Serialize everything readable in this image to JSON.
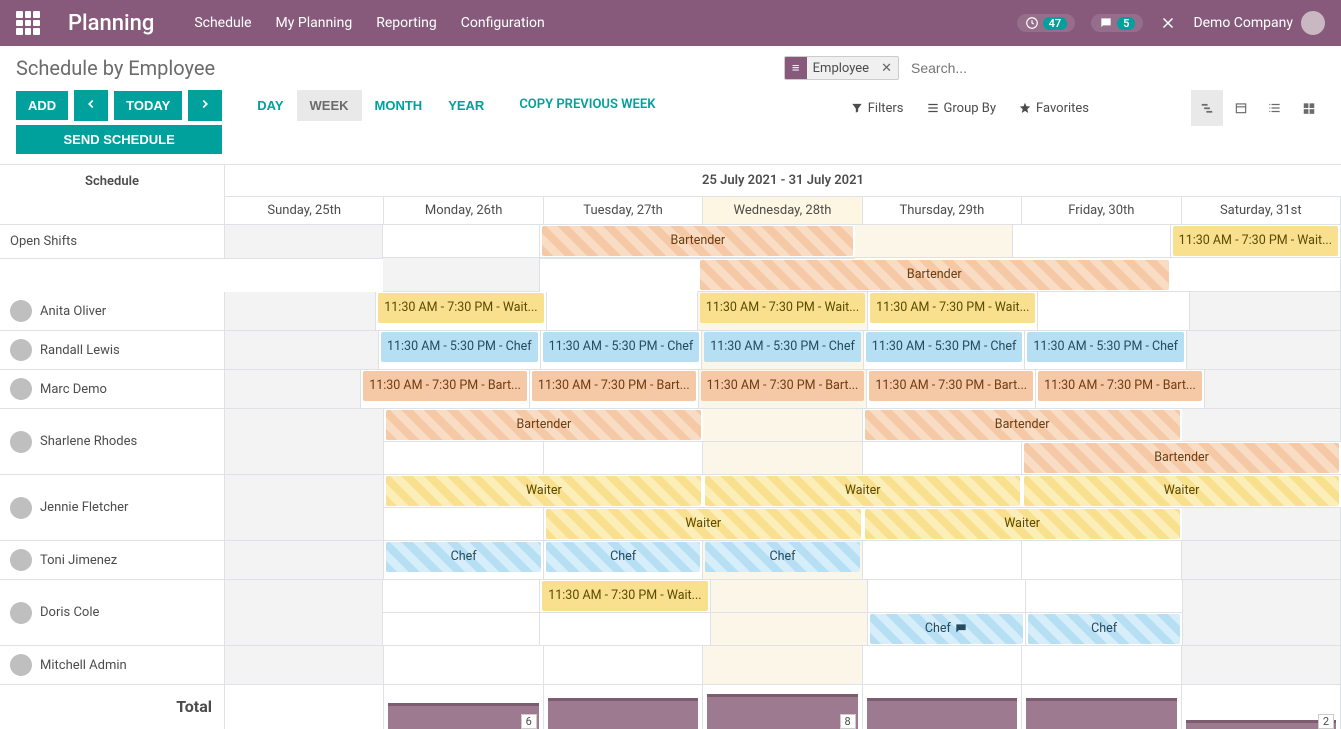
{
  "topbar": {
    "brand": "Planning",
    "nav": [
      "Schedule",
      "My Planning",
      "Reporting",
      "Configuration"
    ],
    "activity_count": "47",
    "chat_count": "5",
    "company": "Demo Company"
  },
  "header": {
    "title": "Schedule by Employee",
    "facet": "Employee",
    "search_placeholder": "Search..."
  },
  "toolbar": {
    "add": "ADD",
    "today": "TODAY",
    "send": "SEND SCHEDULE",
    "scales": {
      "day": "DAY",
      "week": "WEEK",
      "month": "MONTH",
      "year": "YEAR"
    },
    "copy": "COPY PREVIOUS WEEK",
    "filters": "Filters",
    "group_by": "Group By",
    "favorites": "Favorites"
  },
  "gantt": {
    "schedule_label": "Schedule",
    "range": "25 July 2021 - 31 July 2021",
    "days": [
      "Sunday, 25th",
      "Monday, 26th",
      "Tuesday, 27th",
      "Wednesday, 28th",
      "Thursday, 29th",
      "Friday, 30th",
      "Saturday, 31st"
    ],
    "today_index": 3,
    "rows": [
      {
        "name": "Open Shifts",
        "avatar": false
      },
      {
        "name": "Anita Oliver",
        "avatar": true
      },
      {
        "name": "Randall Lewis",
        "avatar": true
      },
      {
        "name": "Marc Demo",
        "avatar": true
      },
      {
        "name": "Sharlene Rhodes",
        "avatar": true
      },
      {
        "name": "Jennie Fletcher",
        "avatar": true
      },
      {
        "name": "Toni Jimenez",
        "avatar": true
      },
      {
        "name": "Doris Cole",
        "avatar": true
      },
      {
        "name": "Mitchell Admin",
        "avatar": true
      }
    ],
    "labels": {
      "bartender": "Bartender",
      "waiter": "Waiter",
      "chef": "Chef",
      "wait_1130_730": "11:30 AM - 7:30 PM - Wait...",
      "chef_1130_530": "11:30 AM - 5:30 PM - Chef",
      "bart_1130_730": "11:30 AM - 7:30 PM - Bart..."
    },
    "total_label": "Total",
    "totals": {
      "mon": "6",
      "wed": "8",
      "sat": "2"
    }
  }
}
